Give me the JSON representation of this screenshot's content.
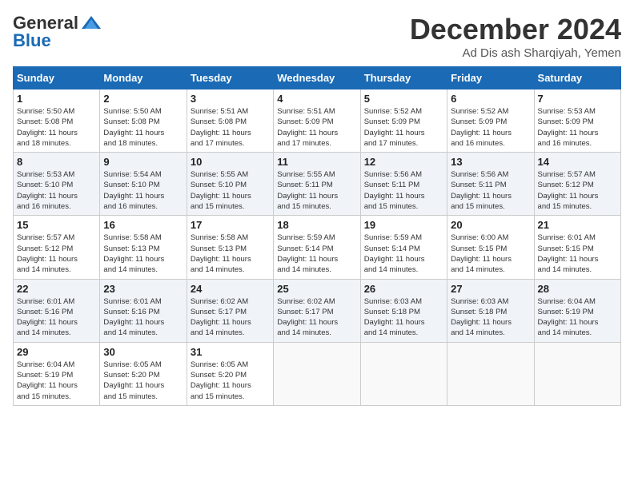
{
  "header": {
    "logo_general": "General",
    "logo_blue": "Blue",
    "month_title": "December 2024",
    "location": "Ad Dis ash Sharqiyah, Yemen"
  },
  "calendar": {
    "days_of_week": [
      "Sunday",
      "Monday",
      "Tuesday",
      "Wednesday",
      "Thursday",
      "Friday",
      "Saturday"
    ],
    "weeks": [
      [
        null,
        null,
        null,
        null,
        null,
        null,
        null
      ]
    ],
    "cells": [
      {
        "date": null,
        "day_num": null,
        "info": null
      },
      {
        "date": null,
        "day_num": null,
        "info": null
      },
      {
        "date": null,
        "day_num": null,
        "info": null
      },
      {
        "date": null,
        "day_num": null,
        "info": null
      },
      {
        "date": null,
        "day_num": null,
        "info": null
      },
      {
        "date": null,
        "day_num": null,
        "info": null
      },
      {
        "day_num": "7",
        "info": "Sunrise: 5:53 AM\nSunset: 5:09 PM\nDaylight: 11 hours\nand 16 minutes."
      },
      {
        "day_num": "1",
        "info": "Sunrise: 5:50 AM\nSunset: 5:08 PM\nDaylight: 11 hours\nand 18 minutes."
      },
      {
        "day_num": "2",
        "info": "Sunrise: 5:50 AM\nSunset: 5:08 PM\nDaylight: 11 hours\nand 18 minutes."
      },
      {
        "day_num": "3",
        "info": "Sunrise: 5:51 AM\nSunset: 5:08 PM\nDaylight: 11 hours\nand 17 minutes."
      },
      {
        "day_num": "4",
        "info": "Sunrise: 5:51 AM\nSunset: 5:09 PM\nDaylight: 11 hours\nand 17 minutes."
      },
      {
        "day_num": "5",
        "info": "Sunrise: 5:52 AM\nSunset: 5:09 PM\nDaylight: 11 hours\nand 17 minutes."
      },
      {
        "day_num": "6",
        "info": "Sunrise: 5:52 AM\nSunset: 5:09 PM\nDaylight: 11 hours\nand 16 minutes."
      },
      {
        "day_num": "7",
        "info": "Sunrise: 5:53 AM\nSunset: 5:09 PM\nDaylight: 11 hours\nand 16 minutes."
      },
      {
        "day_num": "8",
        "info": "Sunrise: 5:53 AM\nSunset: 5:10 PM\nDaylight: 11 hours\nand 16 minutes."
      },
      {
        "day_num": "9",
        "info": "Sunrise: 5:54 AM\nSunset: 5:10 PM\nDaylight: 11 hours\nand 16 minutes."
      },
      {
        "day_num": "10",
        "info": "Sunrise: 5:55 AM\nSunset: 5:10 PM\nDaylight: 11 hours\nand 15 minutes."
      },
      {
        "day_num": "11",
        "info": "Sunrise: 5:55 AM\nSunset: 5:11 PM\nDaylight: 11 hours\nand 15 minutes."
      },
      {
        "day_num": "12",
        "info": "Sunrise: 5:56 AM\nSunset: 5:11 PM\nDaylight: 11 hours\nand 15 minutes."
      },
      {
        "day_num": "13",
        "info": "Sunrise: 5:56 AM\nSunset: 5:11 PM\nDaylight: 11 hours\nand 15 minutes."
      },
      {
        "day_num": "14",
        "info": "Sunrise: 5:57 AM\nSunset: 5:12 PM\nDaylight: 11 hours\nand 15 minutes."
      },
      {
        "day_num": "15",
        "info": "Sunrise: 5:57 AM\nSunset: 5:12 PM\nDaylight: 11 hours\nand 14 minutes."
      },
      {
        "day_num": "16",
        "info": "Sunrise: 5:58 AM\nSunset: 5:13 PM\nDaylight: 11 hours\nand 14 minutes."
      },
      {
        "day_num": "17",
        "info": "Sunrise: 5:58 AM\nSunset: 5:13 PM\nDaylight: 11 hours\nand 14 minutes."
      },
      {
        "day_num": "18",
        "info": "Sunrise: 5:59 AM\nSunset: 5:14 PM\nDaylight: 11 hours\nand 14 minutes."
      },
      {
        "day_num": "19",
        "info": "Sunrise: 5:59 AM\nSunset: 5:14 PM\nDaylight: 11 hours\nand 14 minutes."
      },
      {
        "day_num": "20",
        "info": "Sunrise: 6:00 AM\nSunset: 5:15 PM\nDaylight: 11 hours\nand 14 minutes."
      },
      {
        "day_num": "21",
        "info": "Sunrise: 6:01 AM\nSunset: 5:15 PM\nDaylight: 11 hours\nand 14 minutes."
      },
      {
        "day_num": "22",
        "info": "Sunrise: 6:01 AM\nSunset: 5:16 PM\nDaylight: 11 hours\nand 14 minutes."
      },
      {
        "day_num": "23",
        "info": "Sunrise: 6:01 AM\nSunset: 5:16 PM\nDaylight: 11 hours\nand 14 minutes."
      },
      {
        "day_num": "24",
        "info": "Sunrise: 6:02 AM\nSunset: 5:17 PM\nDaylight: 11 hours\nand 14 minutes."
      },
      {
        "day_num": "25",
        "info": "Sunrise: 6:02 AM\nSunset: 5:17 PM\nDaylight: 11 hours\nand 14 minutes."
      },
      {
        "day_num": "26",
        "info": "Sunrise: 6:03 AM\nSunset: 5:18 PM\nDaylight: 11 hours\nand 14 minutes."
      },
      {
        "day_num": "27",
        "info": "Sunrise: 6:03 AM\nSunset: 5:18 PM\nDaylight: 11 hours\nand 14 minutes."
      },
      {
        "day_num": "28",
        "info": "Sunrise: 6:04 AM\nSunset: 5:19 PM\nDaylight: 11 hours\nand 14 minutes."
      },
      {
        "day_num": "29",
        "info": "Sunrise: 6:04 AM\nSunset: 5:19 PM\nDaylight: 11 hours\nand 15 minutes."
      },
      {
        "day_num": "30",
        "info": "Sunrise: 6:05 AM\nSunset: 5:20 PM\nDaylight: 11 hours\nand 15 minutes."
      },
      {
        "day_num": "31",
        "info": "Sunrise: 6:05 AM\nSunset: 5:20 PM\nDaylight: 11 hours\nand 15 minutes."
      }
    ]
  }
}
